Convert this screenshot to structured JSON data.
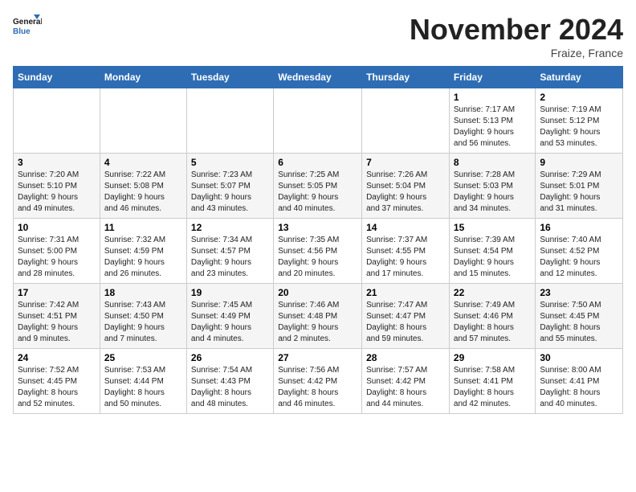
{
  "header": {
    "logo_general": "General",
    "logo_blue": "Blue",
    "month_title": "November 2024",
    "location": "Fraize, France"
  },
  "days_of_week": [
    "Sunday",
    "Monday",
    "Tuesday",
    "Wednesday",
    "Thursday",
    "Friday",
    "Saturday"
  ],
  "weeks": [
    [
      {
        "day": "",
        "info": ""
      },
      {
        "day": "",
        "info": ""
      },
      {
        "day": "",
        "info": ""
      },
      {
        "day": "",
        "info": ""
      },
      {
        "day": "",
        "info": ""
      },
      {
        "day": "1",
        "info": "Sunrise: 7:17 AM\nSunset: 5:13 PM\nDaylight: 9 hours\nand 56 minutes."
      },
      {
        "day": "2",
        "info": "Sunrise: 7:19 AM\nSunset: 5:12 PM\nDaylight: 9 hours\nand 53 minutes."
      }
    ],
    [
      {
        "day": "3",
        "info": "Sunrise: 7:20 AM\nSunset: 5:10 PM\nDaylight: 9 hours\nand 49 minutes."
      },
      {
        "day": "4",
        "info": "Sunrise: 7:22 AM\nSunset: 5:08 PM\nDaylight: 9 hours\nand 46 minutes."
      },
      {
        "day": "5",
        "info": "Sunrise: 7:23 AM\nSunset: 5:07 PM\nDaylight: 9 hours\nand 43 minutes."
      },
      {
        "day": "6",
        "info": "Sunrise: 7:25 AM\nSunset: 5:05 PM\nDaylight: 9 hours\nand 40 minutes."
      },
      {
        "day": "7",
        "info": "Sunrise: 7:26 AM\nSunset: 5:04 PM\nDaylight: 9 hours\nand 37 minutes."
      },
      {
        "day": "8",
        "info": "Sunrise: 7:28 AM\nSunset: 5:03 PM\nDaylight: 9 hours\nand 34 minutes."
      },
      {
        "day": "9",
        "info": "Sunrise: 7:29 AM\nSunset: 5:01 PM\nDaylight: 9 hours\nand 31 minutes."
      }
    ],
    [
      {
        "day": "10",
        "info": "Sunrise: 7:31 AM\nSunset: 5:00 PM\nDaylight: 9 hours\nand 28 minutes."
      },
      {
        "day": "11",
        "info": "Sunrise: 7:32 AM\nSunset: 4:59 PM\nDaylight: 9 hours\nand 26 minutes."
      },
      {
        "day": "12",
        "info": "Sunrise: 7:34 AM\nSunset: 4:57 PM\nDaylight: 9 hours\nand 23 minutes."
      },
      {
        "day": "13",
        "info": "Sunrise: 7:35 AM\nSunset: 4:56 PM\nDaylight: 9 hours\nand 20 minutes."
      },
      {
        "day": "14",
        "info": "Sunrise: 7:37 AM\nSunset: 4:55 PM\nDaylight: 9 hours\nand 17 minutes."
      },
      {
        "day": "15",
        "info": "Sunrise: 7:39 AM\nSunset: 4:54 PM\nDaylight: 9 hours\nand 15 minutes."
      },
      {
        "day": "16",
        "info": "Sunrise: 7:40 AM\nSunset: 4:52 PM\nDaylight: 9 hours\nand 12 minutes."
      }
    ],
    [
      {
        "day": "17",
        "info": "Sunrise: 7:42 AM\nSunset: 4:51 PM\nDaylight: 9 hours\nand 9 minutes."
      },
      {
        "day": "18",
        "info": "Sunrise: 7:43 AM\nSunset: 4:50 PM\nDaylight: 9 hours\nand 7 minutes."
      },
      {
        "day": "19",
        "info": "Sunrise: 7:45 AM\nSunset: 4:49 PM\nDaylight: 9 hours\nand 4 minutes."
      },
      {
        "day": "20",
        "info": "Sunrise: 7:46 AM\nSunset: 4:48 PM\nDaylight: 9 hours\nand 2 minutes."
      },
      {
        "day": "21",
        "info": "Sunrise: 7:47 AM\nSunset: 4:47 PM\nDaylight: 8 hours\nand 59 minutes."
      },
      {
        "day": "22",
        "info": "Sunrise: 7:49 AM\nSunset: 4:46 PM\nDaylight: 8 hours\nand 57 minutes."
      },
      {
        "day": "23",
        "info": "Sunrise: 7:50 AM\nSunset: 4:45 PM\nDaylight: 8 hours\nand 55 minutes."
      }
    ],
    [
      {
        "day": "24",
        "info": "Sunrise: 7:52 AM\nSunset: 4:45 PM\nDaylight: 8 hours\nand 52 minutes."
      },
      {
        "day": "25",
        "info": "Sunrise: 7:53 AM\nSunset: 4:44 PM\nDaylight: 8 hours\nand 50 minutes."
      },
      {
        "day": "26",
        "info": "Sunrise: 7:54 AM\nSunset: 4:43 PM\nDaylight: 8 hours\nand 48 minutes."
      },
      {
        "day": "27",
        "info": "Sunrise: 7:56 AM\nSunset: 4:42 PM\nDaylight: 8 hours\nand 46 minutes."
      },
      {
        "day": "28",
        "info": "Sunrise: 7:57 AM\nSunset: 4:42 PM\nDaylight: 8 hours\nand 44 minutes."
      },
      {
        "day": "29",
        "info": "Sunrise: 7:58 AM\nSunset: 4:41 PM\nDaylight: 8 hours\nand 42 minutes."
      },
      {
        "day": "30",
        "info": "Sunrise: 8:00 AM\nSunset: 4:41 PM\nDaylight: 8 hours\nand 40 minutes."
      }
    ]
  ]
}
